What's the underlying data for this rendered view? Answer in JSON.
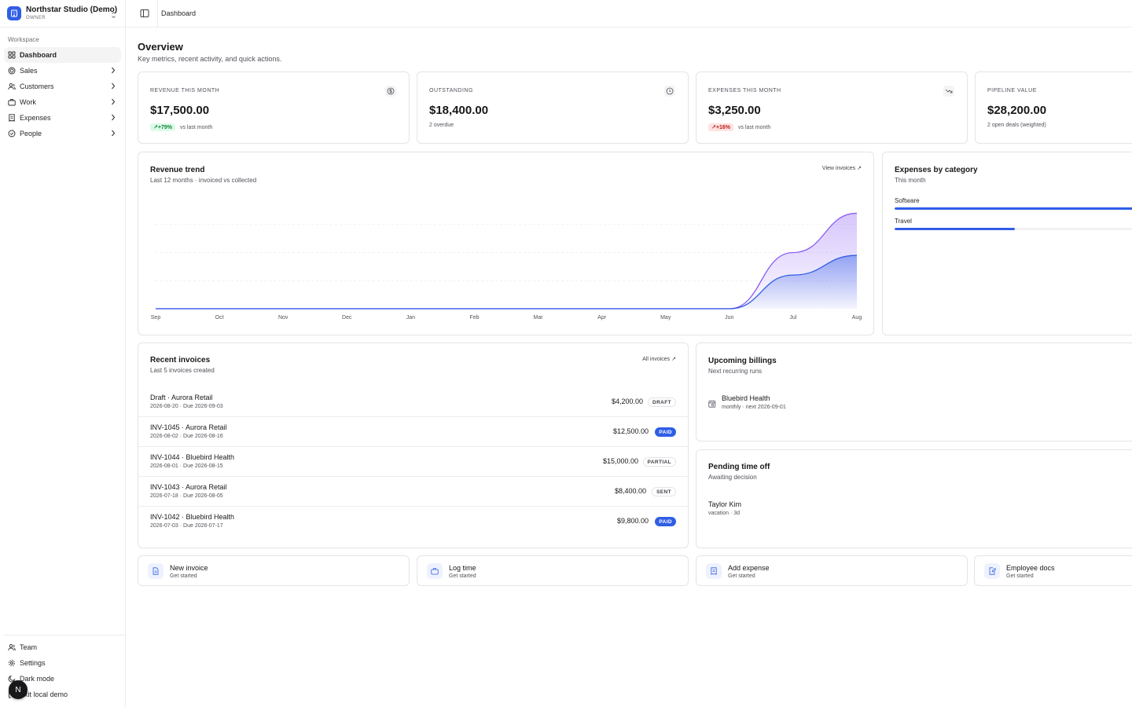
{
  "workspace": {
    "name": "Northstar Studio (Demo)",
    "role": "OWNER",
    "section_label": "Workspace"
  },
  "nav": {
    "items": [
      {
        "label": "Dashboard"
      },
      {
        "label": "Sales"
      },
      {
        "label": "Customers"
      },
      {
        "label": "Work"
      },
      {
        "label": "Expenses"
      },
      {
        "label": "People"
      }
    ],
    "bottom": [
      {
        "label": "Team"
      },
      {
        "label": "Settings"
      },
      {
        "label": "Dark mode"
      },
      {
        "label": "Exit local demo"
      }
    ],
    "avatar_initial": "N"
  },
  "topbar": {
    "breadcrumb": "Dashboard"
  },
  "overview": {
    "title": "Overview",
    "subtitle": "Key metrics, recent activity, and quick actions."
  },
  "stats": [
    {
      "label": "REVENUE THIS MONTH",
      "value": "$17,500.00",
      "badge": "+79%",
      "foot": "vs last month",
      "icon": "dollar-icon"
    },
    {
      "label": "OUTSTANDING",
      "value": "$18,400.00",
      "foot": "2 overdue",
      "icon": "clock-icon"
    },
    {
      "label": "EXPENSES THIS MONTH",
      "value": "$3,250.00",
      "badge": "+16%",
      "foot": "vs last month",
      "icon": "trending-down-icon"
    },
    {
      "label": "PIPELINE VALUE",
      "value": "$28,200.00",
      "foot": "2 open deals (weighted)"
    }
  ],
  "revenue_trend": {
    "title": "Revenue trend",
    "subtitle": "Last 12 months · invoiced vs collected",
    "link": "View invoices ↗"
  },
  "chart_data": {
    "type": "area",
    "title": "Revenue trend",
    "subtitle": "Last 12 months · invoiced vs collected",
    "categories": [
      "Sep",
      "Oct",
      "Nov",
      "Dec",
      "Jan",
      "Feb",
      "Mar",
      "Apr",
      "May",
      "Jun",
      "Jul",
      "Aug"
    ],
    "series": [
      {
        "values": [
          0,
          0,
          0,
          0,
          0,
          0,
          0,
          0,
          0,
          0,
          20000,
          34000
        ],
        "color": "#8b5cf6"
      },
      {
        "values": [
          0,
          0,
          0,
          0,
          0,
          0,
          0,
          0,
          0,
          0,
          12000,
          19000
        ],
        "color": "#2f5ee6"
      }
    ],
    "ylim": [
      0,
      40000
    ],
    "grid": true,
    "legend": "none"
  },
  "expenses_by_category": {
    "title": "Expenses by category",
    "subtitle": "This month",
    "items": [
      {
        "label": "Software",
        "share": 1.0
      },
      {
        "label": "Travel",
        "share": 0.5
      }
    ]
  },
  "recent_invoices": {
    "title": "Recent invoices",
    "subtitle": "Last 5 invoices created",
    "link": "All invoices ↗",
    "rows": [
      {
        "title": "Draft · Aurora Retail",
        "dates": "2026-08-20 · Due 2026-09-03",
        "amount": "$4,200.00",
        "status": "DRAFT"
      },
      {
        "title": "INV-1045 · Aurora Retail",
        "dates": "2026-08-02 · Due 2026-08-16",
        "amount": "$12,500.00",
        "status": "PAID"
      },
      {
        "title": "INV-1044 · Bluebird Health",
        "dates": "2026-08-01 · Due 2026-08-15",
        "amount": "$15,000.00",
        "status": "PARTIAL"
      },
      {
        "title": "INV-1043 · Aurora Retail",
        "dates": "2026-07-18 · Due 2026-08-05",
        "amount": "$8,400.00",
        "status": "SENT"
      },
      {
        "title": "INV-1042 · Bluebird Health",
        "dates": "2026-07-03 · Due 2026-07-17",
        "amount": "$9,800.00",
        "status": "PAID"
      }
    ]
  },
  "upcoming_billings": {
    "title": "Upcoming billings",
    "subtitle": "Next recurring runs",
    "items": [
      {
        "name": "Bluebird Health",
        "schedule": "monthly · next 2026-09-01"
      }
    ]
  },
  "pending_time_off": {
    "title": "Pending time off",
    "subtitle": "Awaiting decision",
    "items": [
      {
        "name": "Taylor Kim",
        "detail": "vacation · 3d"
      }
    ]
  },
  "quick_actions": [
    {
      "title": "New invoice",
      "sub": "Get started",
      "icon": "file-icon"
    },
    {
      "title": "Log time",
      "sub": "Get started",
      "icon": "briefcase-icon"
    },
    {
      "title": "Add expense",
      "sub": "Get started",
      "icon": "receipt-icon"
    },
    {
      "title": "Employee docs",
      "sub": "Get started",
      "icon": "doc-edit-icon"
    }
  ]
}
